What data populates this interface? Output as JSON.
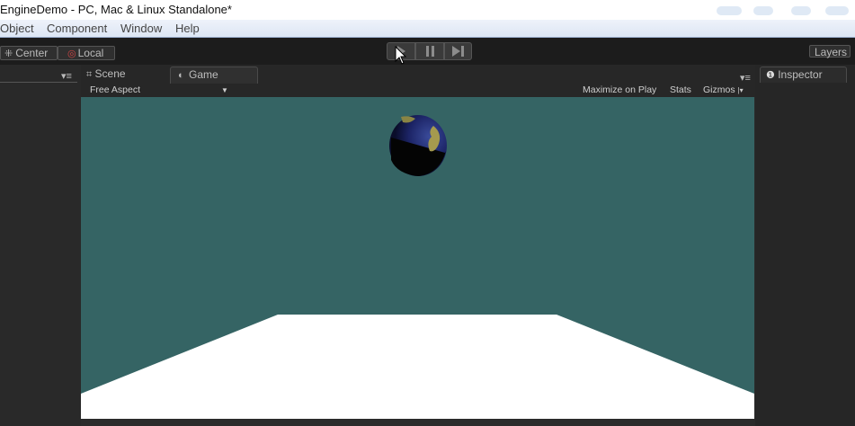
{
  "window": {
    "title": "EngineDemo - PC, Mac & Linux Standalone*"
  },
  "menu": {
    "items": [
      {
        "label": "Object"
      },
      {
        "label": "Component"
      },
      {
        "label": "Window"
      },
      {
        "label": "Help"
      }
    ]
  },
  "toolbar": {
    "pivot_label": "Center",
    "space_label": "Local",
    "layers_label": "Layers"
  },
  "scene_tab": {
    "label": "Scene"
  },
  "game_tab": {
    "label": "Game",
    "aspect_label": "Free Aspect",
    "maximize_label": "Maximize on Play",
    "stats_label": "Stats",
    "gizmos_label": "Gizmos"
  },
  "inspector": {
    "label": "Inspector"
  },
  "colors": {
    "game_background": "#356464",
    "floor": "#ffffff",
    "editor_dark": "#2b2b2b"
  },
  "icons": {
    "pivot": "pivot-icon",
    "local": "local-space-icon",
    "play": "play-icon",
    "pause": "pause-icon",
    "step": "step-icon",
    "scene": "scene-grid-icon",
    "game": "game-controller-icon",
    "inspector": "info-icon",
    "menu": "panel-menu-icon"
  }
}
